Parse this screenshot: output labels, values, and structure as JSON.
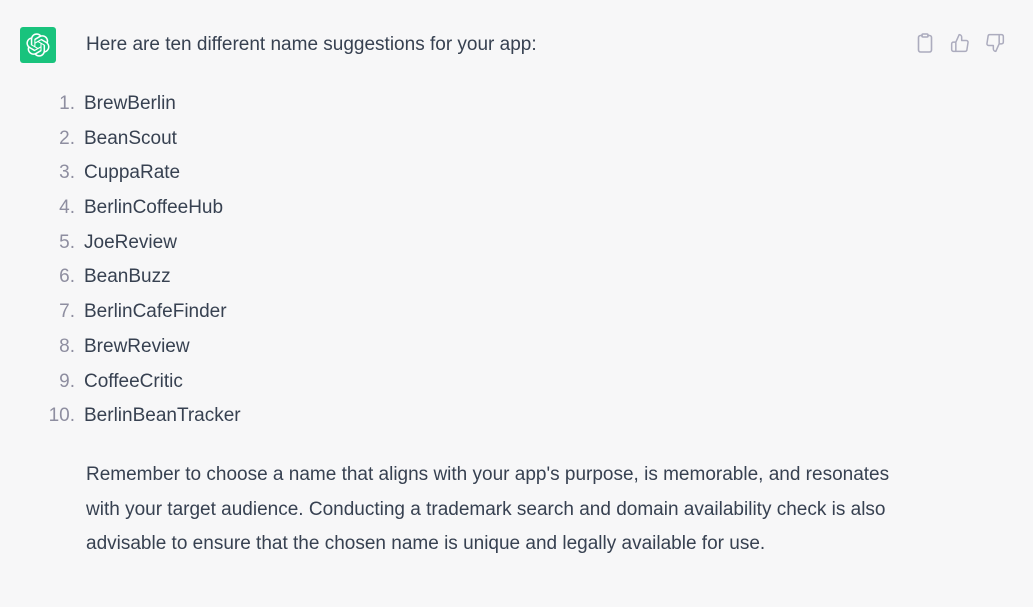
{
  "message": {
    "intro": "Here are ten different name suggestions for your app:",
    "names": [
      {
        "num": "1.",
        "name": "BrewBerlin"
      },
      {
        "num": "2.",
        "name": "BeanScout"
      },
      {
        "num": "3.",
        "name": "CuppaRate"
      },
      {
        "num": "4.",
        "name": "BerlinCoffeeHub"
      },
      {
        "num": "5.",
        "name": "JoeReview"
      },
      {
        "num": "6.",
        "name": "BeanBuzz"
      },
      {
        "num": "7.",
        "name": "BerlinCafeFinder"
      },
      {
        "num": "8.",
        "name": "BrewReview"
      },
      {
        "num": "9.",
        "name": "CoffeeCritic"
      },
      {
        "num": "10.",
        "name": "BerlinBeanTracker"
      }
    ],
    "outro": "Remember to choose a name that aligns with your app's purpose, is memorable, and resonates with your target audience. Conducting a trademark search and domain availability check is also advisable to ensure that the chosen name is unique and legally available for use."
  },
  "actions": {
    "copy_icon": "clipboard-icon",
    "like_icon": "thumbs-up-icon",
    "dislike_icon": "thumbs-down-icon"
  },
  "colors": {
    "background": "#f7f7f8",
    "avatar_bg": "#19c37d",
    "text": "#374151",
    "muted": "#8e8ea0",
    "icon": "#acacbe"
  }
}
